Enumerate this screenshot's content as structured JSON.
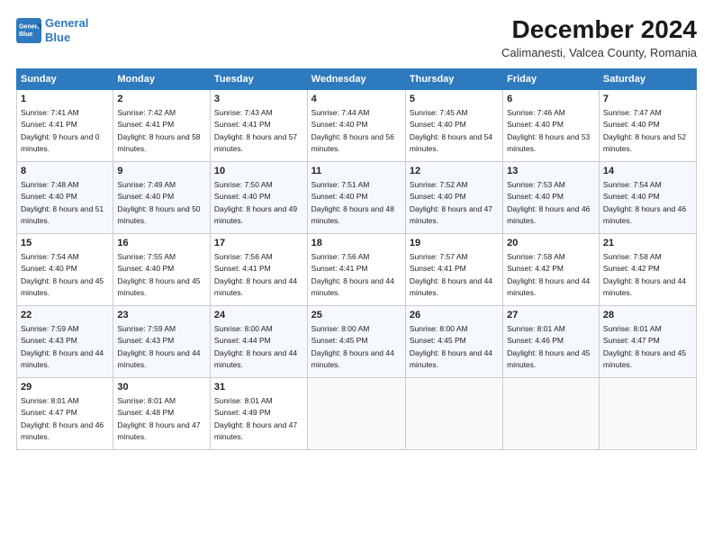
{
  "logo": {
    "line1": "General",
    "line2": "Blue"
  },
  "title": "December 2024",
  "subtitle": "Calimanesti, Valcea County, Romania",
  "headers": [
    "Sunday",
    "Monday",
    "Tuesday",
    "Wednesday",
    "Thursday",
    "Friday",
    "Saturday"
  ],
  "weeks": [
    [
      {
        "day": "1",
        "sunrise": "7:41 AM",
        "sunset": "4:41 PM",
        "daylight": "9 hours and 0 minutes."
      },
      {
        "day": "2",
        "sunrise": "7:42 AM",
        "sunset": "4:41 PM",
        "daylight": "8 hours and 58 minutes."
      },
      {
        "day": "3",
        "sunrise": "7:43 AM",
        "sunset": "4:41 PM",
        "daylight": "8 hours and 57 minutes."
      },
      {
        "day": "4",
        "sunrise": "7:44 AM",
        "sunset": "4:40 PM",
        "daylight": "8 hours and 56 minutes."
      },
      {
        "day": "5",
        "sunrise": "7:45 AM",
        "sunset": "4:40 PM",
        "daylight": "8 hours and 54 minutes."
      },
      {
        "day": "6",
        "sunrise": "7:46 AM",
        "sunset": "4:40 PM",
        "daylight": "8 hours and 53 minutes."
      },
      {
        "day": "7",
        "sunrise": "7:47 AM",
        "sunset": "4:40 PM",
        "daylight": "8 hours and 52 minutes."
      }
    ],
    [
      {
        "day": "8",
        "sunrise": "7:48 AM",
        "sunset": "4:40 PM",
        "daylight": "8 hours and 51 minutes."
      },
      {
        "day": "9",
        "sunrise": "7:49 AM",
        "sunset": "4:40 PM",
        "daylight": "8 hours and 50 minutes."
      },
      {
        "day": "10",
        "sunrise": "7:50 AM",
        "sunset": "4:40 PM",
        "daylight": "8 hours and 49 minutes."
      },
      {
        "day": "11",
        "sunrise": "7:51 AM",
        "sunset": "4:40 PM",
        "daylight": "8 hours and 48 minutes."
      },
      {
        "day": "12",
        "sunrise": "7:52 AM",
        "sunset": "4:40 PM",
        "daylight": "8 hours and 47 minutes."
      },
      {
        "day": "13",
        "sunrise": "7:53 AM",
        "sunset": "4:40 PM",
        "daylight": "8 hours and 46 minutes."
      },
      {
        "day": "14",
        "sunrise": "7:54 AM",
        "sunset": "4:40 PM",
        "daylight": "8 hours and 46 minutes."
      }
    ],
    [
      {
        "day": "15",
        "sunrise": "7:54 AM",
        "sunset": "4:40 PM",
        "daylight": "8 hours and 45 minutes."
      },
      {
        "day": "16",
        "sunrise": "7:55 AM",
        "sunset": "4:40 PM",
        "daylight": "8 hours and 45 minutes."
      },
      {
        "day": "17",
        "sunrise": "7:56 AM",
        "sunset": "4:41 PM",
        "daylight": "8 hours and 44 minutes."
      },
      {
        "day": "18",
        "sunrise": "7:56 AM",
        "sunset": "4:41 PM",
        "daylight": "8 hours and 44 minutes."
      },
      {
        "day": "19",
        "sunrise": "7:57 AM",
        "sunset": "4:41 PM",
        "daylight": "8 hours and 44 minutes."
      },
      {
        "day": "20",
        "sunrise": "7:58 AM",
        "sunset": "4:42 PM",
        "daylight": "8 hours and 44 minutes."
      },
      {
        "day": "21",
        "sunrise": "7:58 AM",
        "sunset": "4:42 PM",
        "daylight": "8 hours and 44 minutes."
      }
    ],
    [
      {
        "day": "22",
        "sunrise": "7:59 AM",
        "sunset": "4:43 PM",
        "daylight": "8 hours and 44 minutes."
      },
      {
        "day": "23",
        "sunrise": "7:59 AM",
        "sunset": "4:43 PM",
        "daylight": "8 hours and 44 minutes."
      },
      {
        "day": "24",
        "sunrise": "8:00 AM",
        "sunset": "4:44 PM",
        "daylight": "8 hours and 44 minutes."
      },
      {
        "day": "25",
        "sunrise": "8:00 AM",
        "sunset": "4:45 PM",
        "daylight": "8 hours and 44 minutes."
      },
      {
        "day": "26",
        "sunrise": "8:00 AM",
        "sunset": "4:45 PM",
        "daylight": "8 hours and 44 minutes."
      },
      {
        "day": "27",
        "sunrise": "8:01 AM",
        "sunset": "4:46 PM",
        "daylight": "8 hours and 45 minutes."
      },
      {
        "day": "28",
        "sunrise": "8:01 AM",
        "sunset": "4:47 PM",
        "daylight": "8 hours and 45 minutes."
      }
    ],
    [
      {
        "day": "29",
        "sunrise": "8:01 AM",
        "sunset": "4:47 PM",
        "daylight": "8 hours and 46 minutes."
      },
      {
        "day": "30",
        "sunrise": "8:01 AM",
        "sunset": "4:48 PM",
        "daylight": "8 hours and 47 minutes."
      },
      {
        "day": "31",
        "sunrise": "8:01 AM",
        "sunset": "4:49 PM",
        "daylight": "8 hours and 47 minutes."
      },
      null,
      null,
      null,
      null
    ]
  ],
  "labels": {
    "sunrise": "Sunrise:",
    "sunset": "Sunset:",
    "daylight": "Daylight:"
  }
}
